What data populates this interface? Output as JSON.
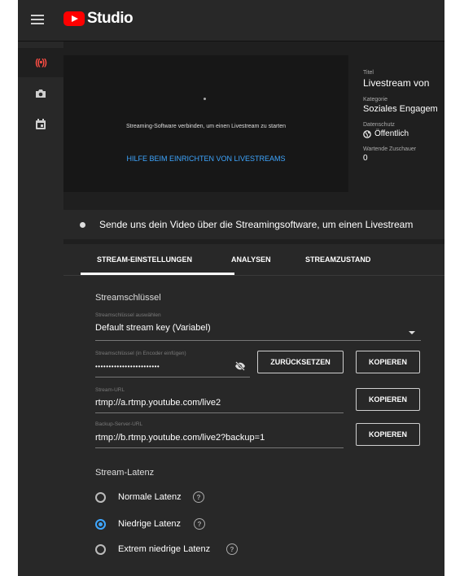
{
  "header": {
    "app_title": "Studio"
  },
  "sidebar": {
    "items": [
      {
        "icon": "live-icon"
      },
      {
        "icon": "camera-icon"
      },
      {
        "icon": "calendar-icon"
      }
    ],
    "live_glyph": "((•))"
  },
  "preview": {
    "message": "Streaming-Software verbinden, um einen Livestream zu starten",
    "help_link": "HILFE BEIM EINRICHTEN VON LIVESTREAMS"
  },
  "info": {
    "title_label": "Titel",
    "title_value": "Livestream von",
    "category_label": "Kategorie",
    "category_value": "Soziales Engagem",
    "privacy_label": "Datenschutz",
    "privacy_value": "Öffentlich",
    "viewers_label": "Wartende Zuschauer",
    "viewers_value": "0"
  },
  "banner": {
    "text": "Sende uns dein Video über die Streamingsoftware, um einen Livestream"
  },
  "tabs": [
    "STREAM-EINSTELLUNGEN",
    "ANALYSEN",
    "STREAMZUSTAND"
  ],
  "stream": {
    "section_title": "Streamschlüssel",
    "select_label": "Streamschlüssel auswählen",
    "select_value": "Default stream key (Variabel)",
    "key_label": "Streamschlüssel (in Encoder einfügen)",
    "key_value": "••••••••••••••••••••••••",
    "reset_button": "ZURÜCKSETZEN",
    "copy_button": "KOPIEREN",
    "url_label": "Stream-URL",
    "url_value": "rtmp://a.rtmp.youtube.com/live2",
    "backup_label": "Backup-Server-URL",
    "backup_value": "rtmp://b.rtmp.youtube.com/live2?backup=1"
  },
  "latency": {
    "title": "Stream-Latenz",
    "options": [
      {
        "label": "Normale Latenz",
        "selected": false
      },
      {
        "label": "Niedrige Latenz",
        "selected": true
      },
      {
        "label": "Extrem niedrige Latenz",
        "selected": false
      }
    ],
    "help_glyph": "?"
  },
  "colors": {
    "accent": "#3ea6ff",
    "live": "#ff4e45",
    "brand": "#ff0000",
    "background": "#1f1f1f",
    "surface": "#282828"
  }
}
